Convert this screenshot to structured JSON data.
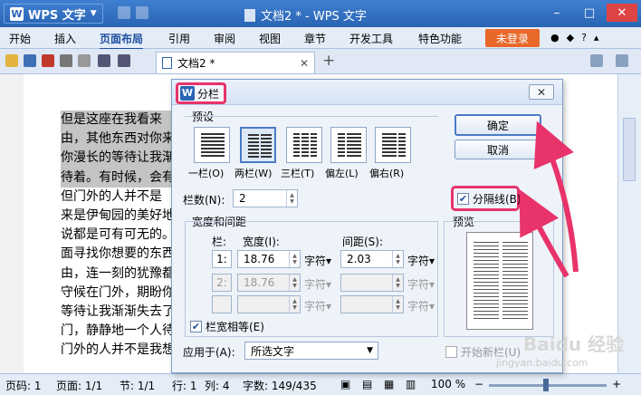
{
  "app": {
    "name": "WPS 文字",
    "window_title": "文档2 * - WPS 文字",
    "window_controls": [
      "–",
      "□",
      "✕"
    ]
  },
  "menu": {
    "items": [
      "开始",
      "插入",
      "页面布局",
      "引用",
      "审阅",
      "视图",
      "章节",
      "开发工具",
      "特色功能"
    ],
    "active": "页面布局",
    "login_label": "未登录"
  },
  "tabs": {
    "doc_tab_label": "文档2 *",
    "close": "✕",
    "new_tab": "+"
  },
  "document": {
    "lines": [
      "但是这座在我看来",
      "由，其他东西对你来",
      "你漫长的等待让我渐",
      "待着。有时候，会有",
      "但门外的人并不是",
      "来是伊甸园的美好地",
      "说都是可有可无的。",
      "面寻找你想要的东西",
      "由，连一刻的犹豫都",
      "守候在门外，期盼你",
      "等待让我渐渐失去了",
      "门，静静地一个人待",
      "门外的人并不是我想"
    ],
    "highlighted_line_count": 4
  },
  "dialog": {
    "title": "分栏",
    "close_label": "✕",
    "preset_group": "预设",
    "presets": [
      {
        "label": "一栏(O)",
        "columns": 1
      },
      {
        "label": "两栏(W)",
        "columns": 2
      },
      {
        "label": "三栏(T)",
        "columns": 3
      },
      {
        "label": "偏左(L)",
        "columns": 2
      },
      {
        "label": "偏右(R)",
        "columns": 2
      }
    ],
    "selected_preset": "两栏(W)",
    "ok_label": "确定",
    "cancel_label": "取消",
    "columns_label": "栏数(N):",
    "columns_value": "2",
    "divider_label": "分隔线(B)",
    "divider_checked": true,
    "width_group": "宽度和间距",
    "col_header": "栏:",
    "width_header": "宽度(I):",
    "spacing_header": "间距(S):",
    "rows": [
      {
        "num": "1:",
        "width": "18.76",
        "width_unit": "字符▾",
        "spacing": "2.03",
        "spacing_unit": "字符▾",
        "enabled": true
      },
      {
        "num": "2:",
        "width": "18.76",
        "width_unit": "字符▾",
        "spacing": "",
        "spacing_unit": "字符▾",
        "enabled": false
      },
      {
        "num": "",
        "width": "",
        "width_unit": "字符▾",
        "spacing": "",
        "spacing_unit": "字符▾",
        "enabled": false
      }
    ],
    "equal_width_label": "栏宽相等(E)",
    "equal_width_checked": true,
    "preview_label": "预览",
    "apply_to_label": "应用于(A):",
    "apply_to_value": "所选文字",
    "new_column_label": "开始新栏(U)",
    "new_column_checked": false
  },
  "status": {
    "page_code": "页码: 1",
    "page": "页面: 1/1",
    "section": "节: 1/1",
    "row": "行: 1",
    "col": "列: 4",
    "words": "字数: 149/435",
    "zoom": "100 %",
    "zoom_level": 1.0
  },
  "watermark": {
    "brand": "Baidu 经验",
    "url": "jingyan.baidu.com"
  },
  "colors": {
    "title_blue": "#2a64b4",
    "highlight_pink": "#e8336b",
    "login_orange": "#e8682a"
  }
}
